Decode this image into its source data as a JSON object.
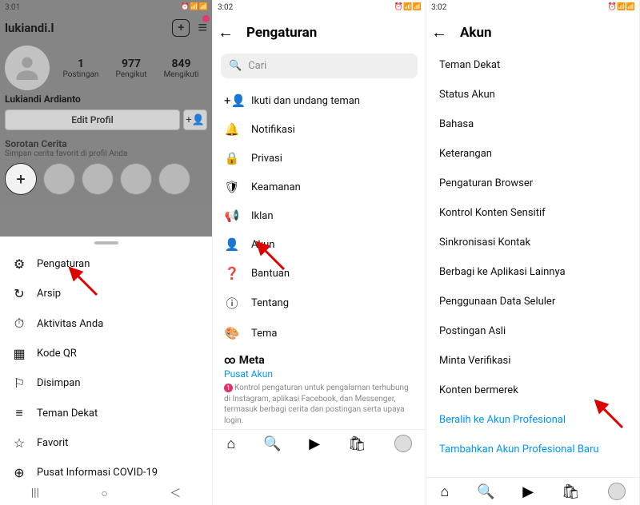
{
  "status": {
    "time1": "3:01",
    "time2": "3:02",
    "time3": "3:02"
  },
  "profile": {
    "username": "lukiandi.l",
    "stats": [
      {
        "num": "1",
        "label": "Postingan"
      },
      {
        "num": "977",
        "label": "Pengikut"
      },
      {
        "num": "849",
        "label": "Mengikuti"
      }
    ],
    "full_name": "Lukiandi Ardianto",
    "edit_btn": "Edit Profil",
    "highlights_title": "Sorotan Cerita",
    "highlights_sub": "Simpan cerita favorit di profil Anda"
  },
  "sheet_menu": [
    {
      "icon": "gear-icon",
      "glyph": "⚙",
      "label": "Pengaturan"
    },
    {
      "icon": "archive-icon",
      "glyph": "↻",
      "label": "Arsip"
    },
    {
      "icon": "activity-icon",
      "glyph": "⏱",
      "label": "Aktivitas Anda"
    },
    {
      "icon": "qr-icon",
      "glyph": "▦",
      "label": "Kode QR"
    },
    {
      "icon": "saved-icon",
      "glyph": "⚐",
      "label": "Disimpan"
    },
    {
      "icon": "close-friends-icon",
      "glyph": "≡",
      "label": "Teman Dekat"
    },
    {
      "icon": "favorite-icon",
      "glyph": "☆",
      "label": "Favorit"
    },
    {
      "icon": "covid-icon",
      "glyph": "⊕",
      "label": "Pusat Informasi COVID-19"
    }
  ],
  "settings": {
    "title": "Pengaturan",
    "search_placeholder": "Cari",
    "items": [
      {
        "icon": "invite-icon",
        "glyph": "+👤",
        "label": "Ikuti dan undang teman"
      },
      {
        "icon": "bell-icon",
        "glyph": "🔔",
        "label": "Notifikasi"
      },
      {
        "icon": "lock-icon",
        "glyph": "🔒",
        "label": "Privasi"
      },
      {
        "icon": "shield-icon",
        "glyph": "🛡",
        "label": "Keamanan"
      },
      {
        "icon": "ads-icon",
        "glyph": "📢",
        "label": "Iklan"
      },
      {
        "icon": "account-icon",
        "glyph": "👤",
        "label": "Akun"
      },
      {
        "icon": "help-icon",
        "glyph": "❓",
        "label": "Bantuan"
      },
      {
        "icon": "about-icon",
        "glyph": "ⓘ",
        "label": "Tentang"
      },
      {
        "icon": "theme-icon",
        "glyph": "🎨",
        "label": "Tema"
      }
    ],
    "meta_brand": "Meta",
    "meta_link": "Pusat Akun",
    "meta_desc": "Kontrol pengaturan untuk pengalaman terhubung di Instagram, aplikasi Facebook, dan Messenger, termasuk berbagi cerita dan postingan serta upaya login."
  },
  "account": {
    "title": "Akun",
    "items": [
      "Teman Dekat",
      "Status Akun",
      "Bahasa",
      "Keterangan",
      "Pengaturan Browser",
      "Kontrol Konten Sensitif",
      "Sinkronisasi Kontak",
      "Berbagi ke Aplikasi Lainnya",
      "Penggunaan Data Seluler",
      "Postingan Asli",
      "Minta Verifikasi",
      "Konten bermerek"
    ],
    "links": [
      "Beralih ke Akun Profesional",
      "Tambahkan Akun Profesional Baru"
    ]
  }
}
